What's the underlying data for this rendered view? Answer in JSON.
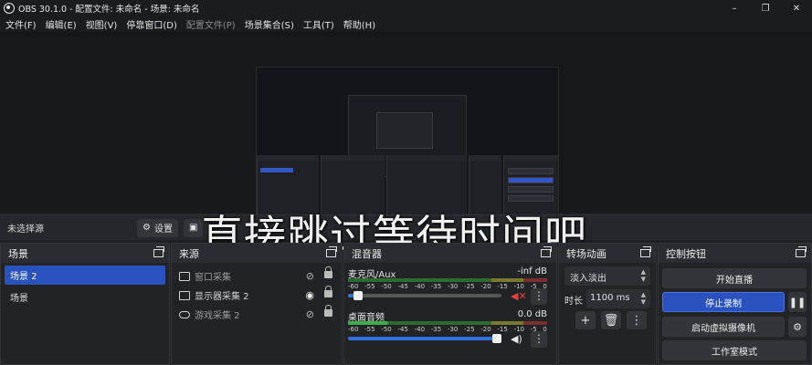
{
  "window": {
    "title": "OBS 30.1.0 - 配置文件: 未命名 - 场景: 未命名",
    "controls": [
      "–",
      "❐",
      "✕"
    ]
  },
  "menu": [
    "文件(F)",
    "编辑(E)",
    "视图(V)",
    "停靠窗口(D)",
    "配置文件(P)",
    "场景集合(S)",
    "工具(T)",
    "帮助(H)"
  ],
  "overlay_text": "直接跳过等待时间吧",
  "source_toolbar": {
    "no_source": "未选择源",
    "settings": "设置"
  },
  "scenes": {
    "title": "场景",
    "items": [
      "场景 2",
      "场景"
    ],
    "selected_index": 0
  },
  "sources": {
    "title": "来源",
    "items": [
      {
        "label": "窗口采集",
        "icon": "window-icon",
        "visible": false
      },
      {
        "label": "显示器采集 2",
        "icon": "monitor-icon",
        "visible": true
      },
      {
        "label": "游戏采集 2",
        "icon": "gamepad-icon",
        "visible": false
      }
    ]
  },
  "mixer": {
    "title": "混音器",
    "scale": [
      "-60",
      "-55",
      "-50",
      "-45",
      "-40",
      "-35",
      "-30",
      "-25",
      "-20",
      "-15",
      "-10",
      "-5",
      "0"
    ],
    "channels": [
      {
        "name": "麦克风/Aux",
        "db": "-inf dB",
        "volume": 0.04,
        "muted": true
      },
      {
        "name": "桌面音频",
        "db": "0.0 dB",
        "volume": 1.0,
        "muted": false
      }
    ]
  },
  "transitions": {
    "title": "转场动画",
    "selected": "淡入淡出",
    "duration_label": "时长",
    "duration_value": "1100 ms"
  },
  "controls": {
    "title": "控制按钮",
    "start_stream": "开始直播",
    "stop_record": "停止录制",
    "virtual_cam": "启动虚拟摄像机",
    "studio_mode": "工作室模式"
  },
  "colors": {
    "accent": "#2a52be",
    "mute_red": "#e0453b"
  }
}
